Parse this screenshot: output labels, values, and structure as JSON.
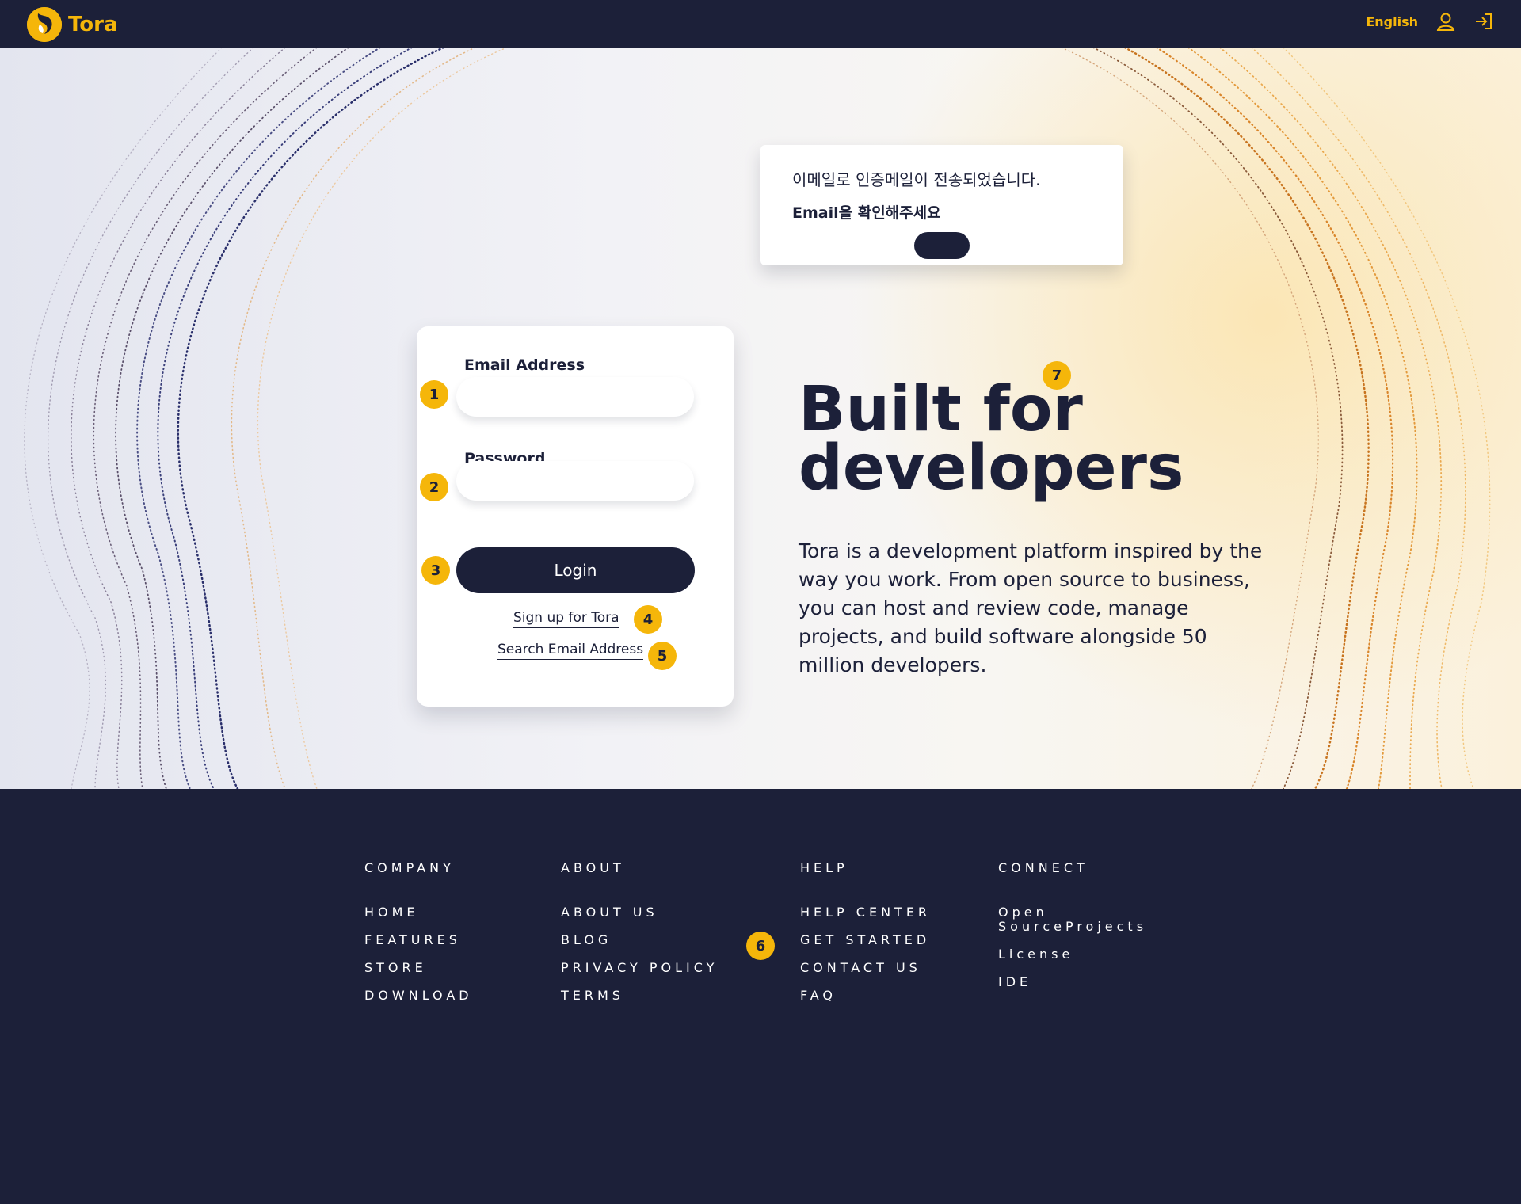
{
  "header": {
    "brand": "Tora",
    "language": "English",
    "icons": {
      "account": "user-icon",
      "login": "sign-in-icon"
    }
  },
  "colors": {
    "navy": "#1c2039",
    "accent": "#f5b60a",
    "white": "#ffffff"
  },
  "toast": {
    "line1": "이메일로 인증메일이 전송되었습니다.",
    "line2": "Email을 확인해주세요"
  },
  "login": {
    "email_label": "Email Address",
    "password_label": "Password",
    "login_button": "Login",
    "signup_link": "Sign up for Tora",
    "search_email_link": "Search Email Address"
  },
  "hero": {
    "headline_line1": "Built for",
    "headline_line2": "developers",
    "description": "Tora is a development platform inspired by the way you work. From open source to business, you can host and review code, manage projects, and build software alongside 50 million developers."
  },
  "badges": [
    "1",
    "2",
    "3",
    "4",
    "5",
    "6",
    "7"
  ],
  "footer": {
    "columns": [
      {
        "title": "COMPANY",
        "items": [
          "HOME",
          "FEATURES",
          "STORE",
          "DOWNLOAD"
        ]
      },
      {
        "title": "ABOUT",
        "items": [
          "ABOUT US",
          "BLOG",
          "PRIVACY POLICY",
          "TERMS"
        ]
      },
      {
        "title": "HELP",
        "items": [
          "HELP CENTER",
          "GET STARTED",
          "CONTACT US",
          "FAQ"
        ]
      },
      {
        "title": "CONNECT",
        "items": [
          "Open SourceProjects",
          "License",
          "IDE"
        ]
      }
    ]
  }
}
